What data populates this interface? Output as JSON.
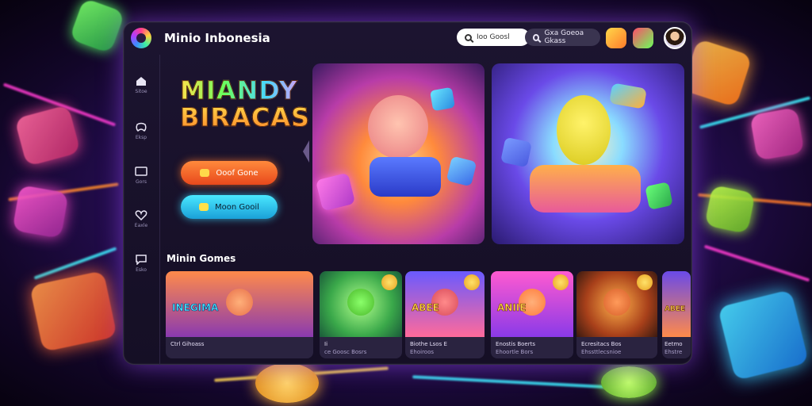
{
  "app": {
    "title": "Minio Inbonesia"
  },
  "search": {
    "primary_placeholder": "Ioo Goosl",
    "secondary_placeholder": "Gxa Goeoa Gkass"
  },
  "sidebar": {
    "items": [
      {
        "label": "Sitoe",
        "icon": "home-icon"
      },
      {
        "label": "Eksp",
        "icon": "controller-icon"
      },
      {
        "label": "Gors",
        "icon": "tv-icon"
      },
      {
        "label": "Eaxle",
        "icon": "heart-icon"
      },
      {
        "label": "Esko",
        "icon": "chat-icon"
      }
    ]
  },
  "hero": {
    "title_line1": "MIANDY",
    "title_line2": "BIRACAS",
    "primary_button": "Ooof Gone",
    "secondary_button": "Moon Gooil"
  },
  "section": {
    "title": "Minin Gomes"
  },
  "cards": [
    {
      "label": "INEGIMA",
      "caption": "Ctrl Gihoass",
      "subcaption": ""
    },
    {
      "label": "",
      "caption": "Ii",
      "subcaption": "ce Goosc Bosrs"
    },
    {
      "label": "ABEE",
      "caption": "Biothe Lsos E",
      "subcaption": "Ehoiroos"
    },
    {
      "label": "ANIIE",
      "caption": "Enostis Boerts",
      "subcaption": "Ehoortle Bors"
    },
    {
      "label": "",
      "caption": "Ecresitacs Bos",
      "subcaption": "Ehssttlecsnioe"
    },
    {
      "label": "ABEE",
      "caption": "Eetmo",
      "subcaption": "Ehstre"
    }
  ],
  "colors": {
    "accent_orange": "#ff7a30",
    "accent_cyan": "#3cd8ff",
    "panel": "#1c1430"
  }
}
